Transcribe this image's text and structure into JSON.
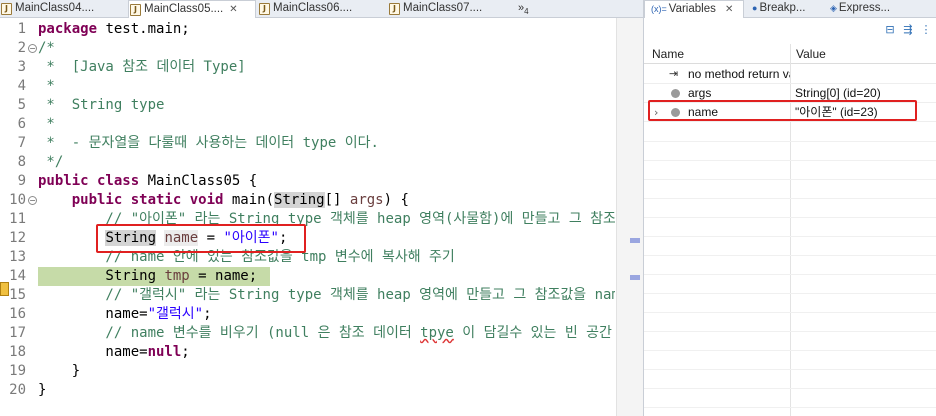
{
  "editor": {
    "tabs": [
      {
        "label": "MainClass04....",
        "active": false
      },
      {
        "label": "MainClass05....",
        "active": true,
        "close": "✕"
      },
      {
        "label": "MainClass06....",
        "active": false
      },
      {
        "label": "MainClass07....",
        "active": false
      }
    ],
    "overflow_label": "»",
    "overflow_count": "4",
    "line_numbers": [
      "1",
      "2",
      "3",
      "4",
      "5",
      "6",
      "7",
      "8",
      "9",
      "10",
      "11",
      "12",
      "13",
      "14",
      "15",
      "16",
      "17",
      "18",
      "19",
      "20"
    ],
    "lines": [
      [
        {
          "t": "package",
          "c": "kw"
        },
        {
          "t": " test.main;",
          "c": "plain"
        }
      ],
      [
        {
          "t": "/*",
          "c": "cm"
        }
      ],
      [
        {
          "t": " *  [Java 참조 데이터 Type]",
          "c": "cm"
        }
      ],
      [
        {
          "t": " *",
          "c": "cm"
        }
      ],
      [
        {
          "t": " *  String type",
          "c": "cm"
        }
      ],
      [
        {
          "t": " *",
          "c": "cm"
        }
      ],
      [
        {
          "t": " *  - 문자열을 다룰때 사용하는 데이터 type 이다.",
          "c": "cm"
        }
      ],
      [
        {
          "t": " */",
          "c": "cm"
        }
      ],
      [
        {
          "t": "public class",
          "c": "kw"
        },
        {
          "t": " MainClass05 {",
          "c": "plain"
        }
      ],
      [
        {
          "t": "    public static void",
          "c": "kw"
        },
        {
          "t": " main(",
          "c": "plain"
        },
        {
          "t": "String",
          "c": "sel"
        },
        {
          "t": "[] ",
          "c": "plain"
        },
        {
          "t": "args",
          "c": "var"
        },
        {
          "t": ") {",
          "c": "plain"
        }
      ],
      [
        {
          "t": "        // \"아이폰\" 라는 String type 객체를 heap 영역(사물함)에 만들고 그 참조값을",
          "c": "cm"
        }
      ],
      [
        {
          "t": "        ",
          "c": "plain"
        },
        {
          "t": "String",
          "c": "sel"
        },
        {
          "t": " ",
          "c": "plain"
        },
        {
          "t": "name",
          "c": "namehl"
        },
        {
          "t": " = ",
          "c": "plain"
        },
        {
          "t": "\"아이폰\"",
          "c": "str"
        },
        {
          "t": ";",
          "c": "plain"
        }
      ],
      [
        {
          "t": "        // name 안에 있는 참조값을 tmp 변수에 복사해 주기",
          "c": "cm"
        }
      ],
      [
        {
          "t": "        String ",
          "c": "plain"
        },
        {
          "t": "tmp",
          "c": "var"
        },
        {
          "t": " = name;",
          "c": "plain"
        }
      ],
      [
        {
          "t": "        // \"갤럭시\" 라는 String type 객체를 heap 영역에 만들고 그 참조값을 name",
          "c": "cm"
        }
      ],
      [
        {
          "t": "        name=",
          "c": "plain"
        },
        {
          "t": "\"갤럭시\"",
          "c": "str"
        },
        {
          "t": ";",
          "c": "plain"
        }
      ],
      [
        {
          "t": "        // name 변수를 비우기 (null 은 참조 데이터 ",
          "c": "cm"
        },
        {
          "t": "tpye",
          "c": "warn"
        },
        {
          "t": " 이 담길수 있는 빈 공간",
          "c": "cm"
        }
      ],
      [
        {
          "t": "        name=",
          "c": "plain"
        },
        {
          "t": "null",
          "c": "kw"
        },
        {
          "t": ";",
          "c": "plain"
        }
      ],
      [
        {
          "t": "    }",
          "c": "plain"
        }
      ],
      [
        {
          "t": "}",
          "c": "plain"
        }
      ]
    ]
  },
  "variables_panel": {
    "tabs": [
      {
        "glyph": "(x)=",
        "label": "Variables",
        "close": "✕",
        "active": true
      },
      {
        "glyph": "●",
        "label": "Breakp...",
        "active": false
      },
      {
        "glyph": "◈",
        "label": "Express...",
        "active": false
      }
    ],
    "header": {
      "name": "Name",
      "value": "Value"
    },
    "rows": [
      {
        "name": "no method return value",
        "value": "",
        "icon": "return-icon"
      },
      {
        "name": "args",
        "value": "String[0]  (id=20)",
        "icon": "local-var-icon"
      },
      {
        "name": "name",
        "value": "\"아이폰\" (id=23)",
        "icon": "local-var-icon",
        "expander": "›"
      }
    ]
  },
  "colors": {
    "keyword": "#7f0055",
    "comment": "#3f7f5f",
    "string": "#2a00ff",
    "debug_line": "#c6dba8",
    "highlight_box": "#e02020"
  }
}
